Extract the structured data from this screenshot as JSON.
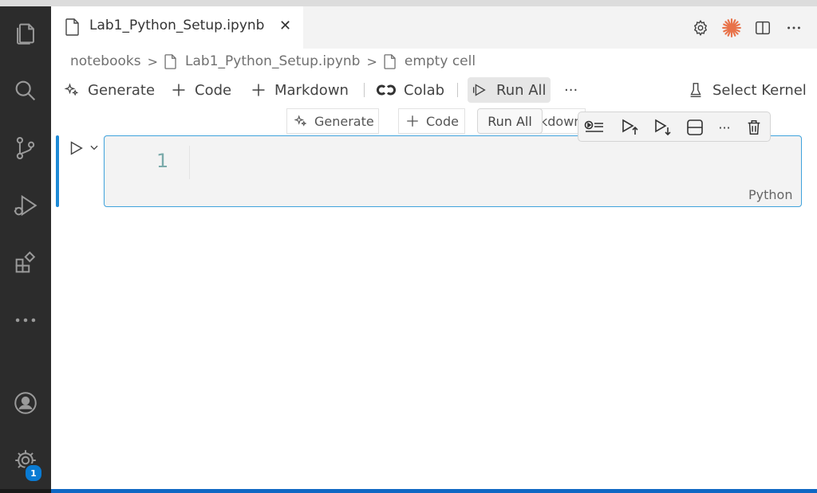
{
  "editor": {
    "tab_title": "Lab1_Python_Setup.ipynb",
    "close_glyph": "✕"
  },
  "breadcrumb": {
    "folder": "notebooks",
    "file": "Lab1_Python_Setup.ipynb",
    "cell": "empty cell"
  },
  "toolbar": {
    "generate": "Generate",
    "code": "Code",
    "markdown": "Markdown",
    "colab": "Colab",
    "run_all": "Run All",
    "more": "···",
    "select_kernel": "Select Kernel"
  },
  "tooltip": {
    "text": "Run All"
  },
  "hover_buttons": {
    "generate": "Generate",
    "code": "Code",
    "markdown_fragment": "kdown"
  },
  "cell": {
    "line_number": "1",
    "language": "Python"
  },
  "cell_toolbar": {
    "more": "···"
  },
  "activity_bar": {
    "settings_badge": "1"
  },
  "colors": {
    "accent": "#1d8ad6",
    "activity_bar": "#2c2c2c",
    "copilot_spark": "#e8734a"
  },
  "icons": {
    "activity": [
      "files-icon",
      "search-icon",
      "source-control-icon",
      "run-debug-icon",
      "extensions-icon",
      "more-icon",
      "account-icon",
      "settings-gear-icon"
    ],
    "title_actions": [
      "gear-icon",
      "spark-icon",
      "split-editor-icon",
      "more-icon"
    ],
    "cell_toolbar": [
      "execute-above-icon",
      "run-above-icon",
      "run-below-icon",
      "split-cell-icon",
      "more-icon",
      "delete-icon"
    ]
  }
}
